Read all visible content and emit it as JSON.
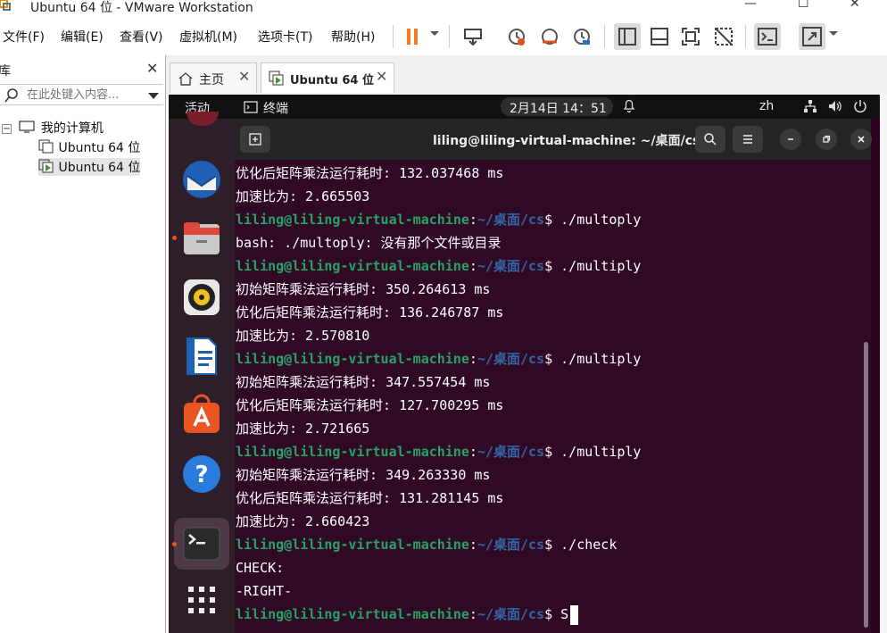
{
  "window": {
    "title": "Ubuntu 64 位 - VMware Workstation",
    "minimize": "—",
    "maximize": "☐",
    "close": "✕"
  },
  "menu": {
    "items": [
      "文件(F)",
      "编辑(E)",
      "查看(V)",
      "虚拟机(M)",
      "选项卡(T)",
      "帮助(H)"
    ]
  },
  "toolbar": {
    "buttons": [
      "pause-icon",
      "send-ctrl-alt-del-icon",
      "snapshot-take-icon",
      "snapshot-revert-icon",
      "snapshot-manager-icon",
      "library-view-icon",
      "thumbnail-view-icon",
      "fullscreen-icon",
      "unity-icon",
      "console-view-icon",
      "stretch-icon"
    ]
  },
  "library": {
    "title": "库",
    "close": "✕",
    "search_placeholder": "在此处键入内容...",
    "tree": {
      "root": "我的计算机",
      "children": [
        "Ubuntu 64 位",
        "Ubuntu 64 位"
      ]
    }
  },
  "tabs": [
    {
      "label": "主页",
      "close": "✕"
    },
    {
      "label": "Ubuntu 64 位",
      "close": "✕"
    }
  ],
  "gnome": {
    "activities": "活动",
    "app": "终端",
    "clock": "2月14日  14：51",
    "lang": "zh"
  },
  "terminal": {
    "title": "liling@liling-virtual-machine: ~/桌面/cs",
    "prompt_user": "liling@liling-virtual-machine",
    "prompt_path": "~/桌面/cs",
    "lines": [
      {
        "type": "out",
        "text": "优化后矩阵乘法运行耗时: 132.037468 ms"
      },
      {
        "type": "out",
        "text": "加速比为: 2.665503"
      },
      {
        "type": "cmd",
        "text": " ./multoply"
      },
      {
        "type": "out",
        "text": "bash: ./multoply: 没有那个文件或目录"
      },
      {
        "type": "cmd",
        "text": " ./multiply"
      },
      {
        "type": "out",
        "text": "初始矩阵乘法运行耗时: 350.264613 ms"
      },
      {
        "type": "out",
        "text": "优化后矩阵乘法运行耗时: 136.246787 ms"
      },
      {
        "type": "out",
        "text": "加速比为: 2.570810"
      },
      {
        "type": "cmd",
        "text": " ./multiply"
      },
      {
        "type": "out",
        "text": "初始矩阵乘法运行耗时: 347.557454 ms"
      },
      {
        "type": "out",
        "text": "优化后矩阵乘法运行耗时: 127.700295 ms"
      },
      {
        "type": "out",
        "text": "加速比为: 2.721665"
      },
      {
        "type": "cmd",
        "text": " ./multiply"
      },
      {
        "type": "out",
        "text": "初始矩阵乘法运行耗时: 349.263330 ms"
      },
      {
        "type": "out",
        "text": "优化后矩阵乘法运行耗时: 131.281145 ms"
      },
      {
        "type": "out",
        "text": "加速比为: 2.660423"
      },
      {
        "type": "cmd",
        "text": " ./check"
      },
      {
        "type": "out",
        "text": "CHECK:"
      },
      {
        "type": "out",
        "text": "-RIGHT-"
      },
      {
        "type": "cmd",
        "text": " S",
        "cursor": true
      }
    ]
  },
  "colors": {
    "terminal_bg": "#300a24",
    "prompt_user": "#26a269",
    "prompt_path": "#3465a4",
    "accent": "#e95420"
  }
}
